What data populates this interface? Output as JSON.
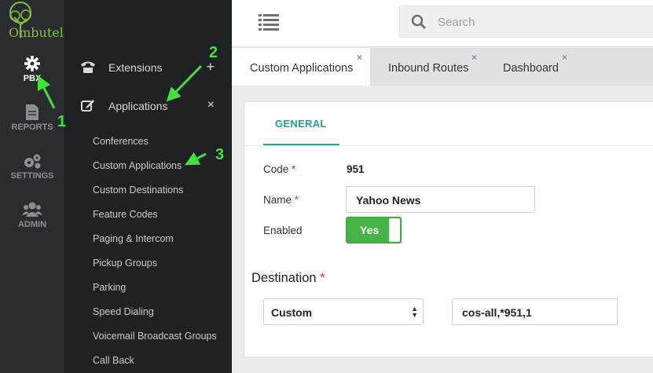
{
  "app": {
    "logo_text": "Ombutel"
  },
  "rail": {
    "items": [
      {
        "label": "PBX",
        "icon": "gear-icon",
        "active": true
      },
      {
        "label": "REPORTS",
        "icon": "document-icon",
        "active": false
      },
      {
        "label": "SETTINGS",
        "icon": "gears-icon",
        "active": false
      },
      {
        "label": "ADMIN",
        "icon": "users-icon",
        "active": false
      }
    ]
  },
  "sidebar": {
    "sections": [
      {
        "label": "Extensions",
        "icon": "phone-icon",
        "action": "+"
      },
      {
        "label": "Applications",
        "icon": "edit-icon",
        "action": "×"
      }
    ],
    "app_items": [
      "Conferences",
      "Custom Applications",
      "Custom Destinations",
      "Feature Codes",
      "Paging & Intercom",
      "Pickup Groups",
      "Parking",
      "Speed Dialing",
      "Voicemail Broadcast Groups",
      "Call Back"
    ]
  },
  "search": {
    "placeholder": "Search"
  },
  "tabs": [
    {
      "label": "Custom Applications",
      "active": true
    },
    {
      "label": "Inbound Routes",
      "active": false
    },
    {
      "label": "Dashboard",
      "active": false
    }
  ],
  "tab_close": "×",
  "form": {
    "tab_label": "GENERAL",
    "code_label": "Code",
    "code_value": "951",
    "name_label": "Name",
    "name_value": "Yahoo News",
    "enabled_label": "Enabled",
    "enabled_value": "Yes",
    "required_mark": "*",
    "destination_title": "Destination",
    "destination_type": "Custom",
    "destination_value": "cos-all,*951,1"
  },
  "annotations": [
    "1",
    "2",
    "3"
  ],
  "colors": {
    "accent": "#1aa39a",
    "toggle_on": "#46b348",
    "annotation": "#44e03c",
    "logo": "#86bd3b"
  }
}
